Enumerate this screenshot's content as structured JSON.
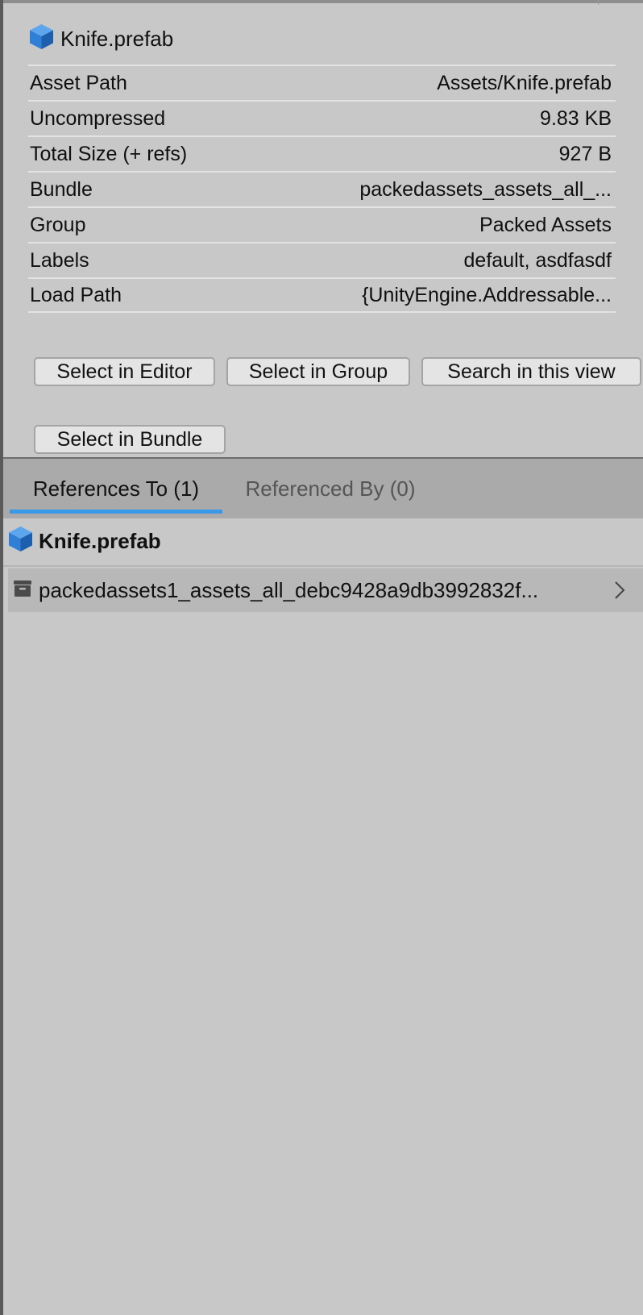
{
  "asset": {
    "name": "Knife.prefab",
    "icon": "prefab-cube-icon"
  },
  "properties": [
    {
      "label": "Asset Path",
      "value": "Assets/Knife.prefab"
    },
    {
      "label": "Uncompressed",
      "value": "9.83 KB"
    },
    {
      "label": "Total Size (+ refs)",
      "value": "927 B"
    },
    {
      "label": "Bundle",
      "value": "packedassets_assets_all_..."
    },
    {
      "label": "Group",
      "value": "Packed Assets"
    },
    {
      "label": "Labels",
      "value": "default, asdfasdf"
    },
    {
      "label": "Load Path",
      "value": "{UnityEngine.Addressable..."
    }
  ],
  "buttons": {
    "select_in_editor": "Select in Editor",
    "select_in_group": "Select in Group",
    "search_in_view": "Search in this view",
    "select_in_bundle": "Select in Bundle"
  },
  "tabs": [
    {
      "label": "References To (1)",
      "active": true
    },
    {
      "label": "Referenced By (0)",
      "active": false
    }
  ],
  "tree": {
    "root_label": "Knife.prefab",
    "children": [
      {
        "label": "packedassets1_assets_all_debc9428a9db3992832f...",
        "icon": "bundle-archive-icon"
      }
    ]
  },
  "colors": {
    "accent": "#3a98e8",
    "prefab_blue": "#2f7fd6",
    "background": "#c8c8c8"
  }
}
